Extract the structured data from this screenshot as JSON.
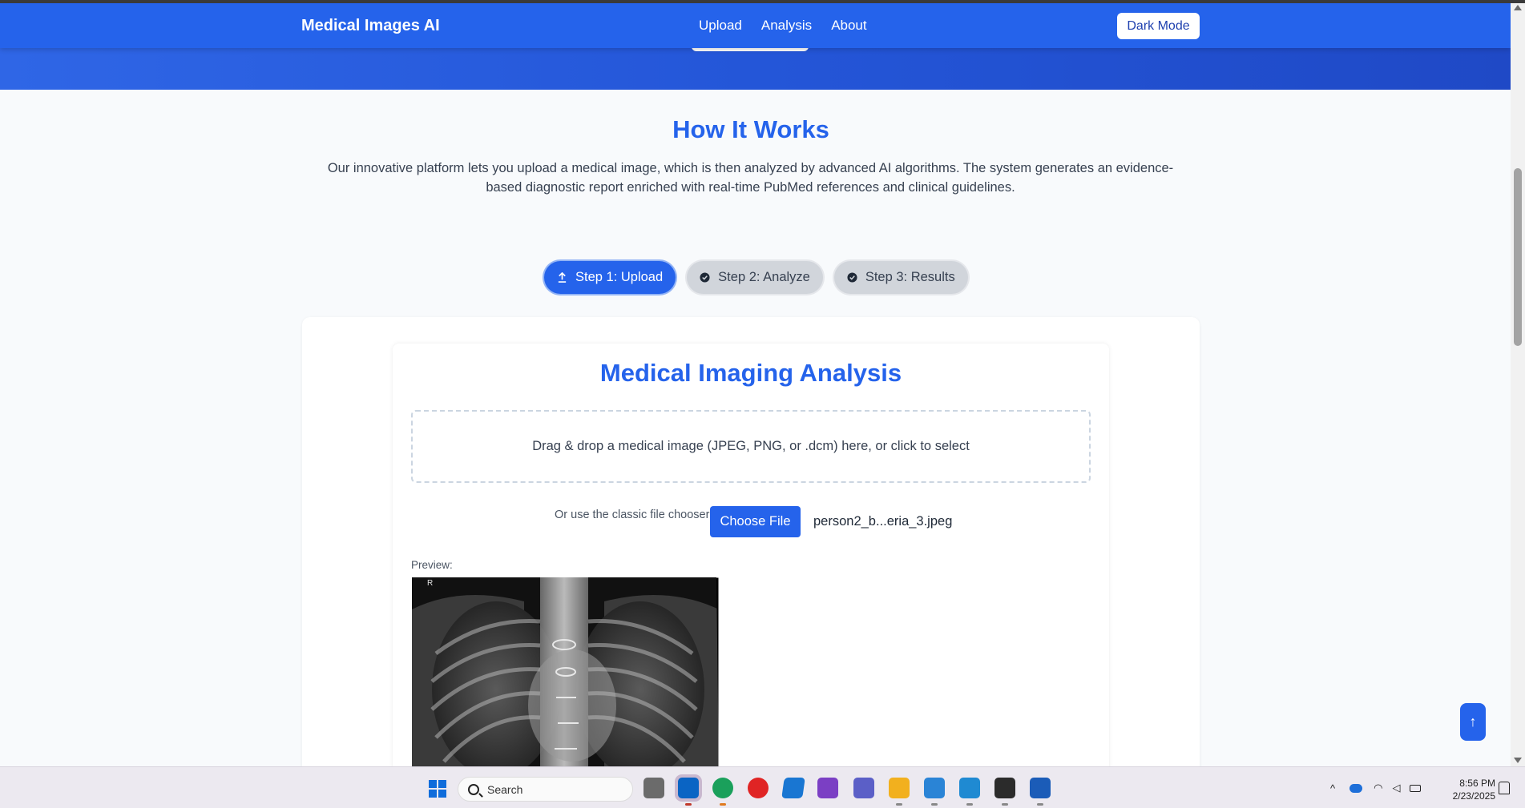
{
  "navbar": {
    "brand": "Medical Images AI",
    "links": [
      "Upload",
      "Analysis",
      "About"
    ],
    "dark_mode_label": "Dark Mode"
  },
  "how_it_works": {
    "title": "How It Works",
    "text": "Our innovative platform lets you upload a medical image, which is then analyzed by advanced AI algorithms. The system generates an evidence-based diagnostic report enriched with real-time PubMed references and clinical guidelines."
  },
  "steps": [
    {
      "label": "Step 1: Upload",
      "icon": "upload-icon",
      "active": true
    },
    {
      "label": "Step 2: Analyze",
      "icon": "check-circle-icon",
      "active": false
    },
    {
      "label": "Step 3: Results",
      "icon": "check-circle-icon",
      "active": false
    }
  ],
  "analysis": {
    "title": "Medical Imaging Analysis",
    "dropzone_text": "Drag & drop a medical image (JPEG, PNG, or .dcm) here, or click to select",
    "chooser_label": "Or use the classic file chooser:",
    "choose_button": "Choose File",
    "file_name": "person2_b...eria_3.jpeg",
    "preview_label": "Preview:",
    "xray_marker": "R"
  },
  "scroll_top_icon": "↑",
  "taskbar": {
    "search_placeholder": "Search",
    "time": "8:56 PM",
    "date": "2/23/2025"
  },
  "colors": {
    "primary": "#2563eb",
    "navbar": "#2563eb",
    "page_bg": "#f8fafc",
    "step_inactive": "#d1d5db"
  }
}
